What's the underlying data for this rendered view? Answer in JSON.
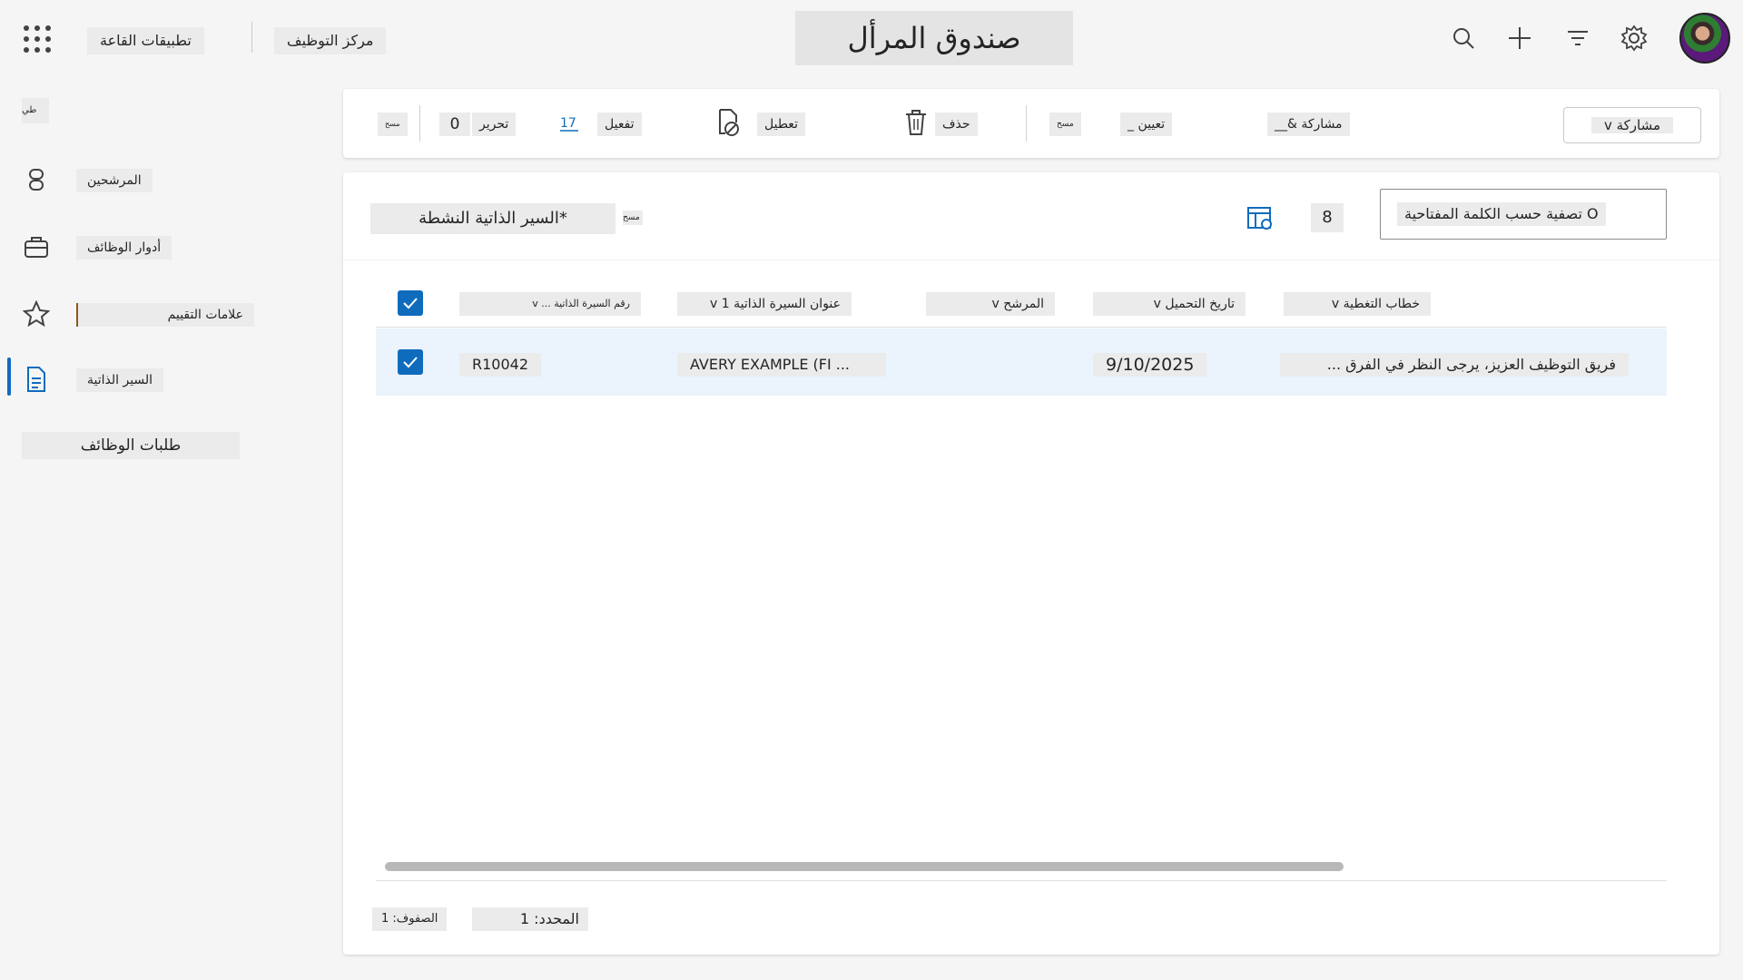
{
  "header": {
    "app_links": [
      "تطبيقات القاعة",
      "مركز التوظيف"
    ],
    "page_title": "صندوق المرأل",
    "icons": [
      "waffle-icon",
      "search-icon",
      "plus-icon",
      "filter-icon",
      "gear-icon",
      "avatar"
    ]
  },
  "sidebar": {
    "collapse_label": "طي",
    "items": [
      {
        "label": "المرشحين",
        "icon": "people-icon"
      },
      {
        "label": "أدوار الوظائف",
        "icon": "briefcase-icon"
      },
      {
        "label": "علامات التقييم",
        "icon": "star-icon"
      },
      {
        "label": "السير الذاتية",
        "icon": "document-icon"
      }
    ],
    "manage_label": "طلبات الوظائف"
  },
  "commandbar": {
    "view_selector": "مشاركة v",
    "share_label": "مشاركة &__",
    "assign_label": "تعيين _",
    "more_label": "مسح",
    "delete_label": "حذف",
    "deactivate_label": "تعطيل",
    "activate_label": "تفعيل",
    "activate_number": "17",
    "counter_label": "تحرير",
    "counter_value": "0",
    "overflow_label": "مسح"
  },
  "view": {
    "name": "*السير الذاتية النشطة",
    "chevron": "مسح",
    "count": "8",
    "search_placeholder": "O تصفية حسب الكلمة المفتاحية"
  },
  "table": {
    "columns": [
      "رقم السيرة الذاتية ... v",
      "عنوان السيرة الذاتية 1 v",
      "المرشح v",
      "تاريخ التحميل v",
      "خطاب التغطية v"
    ],
    "rows": [
      {
        "id": "R10042",
        "title": "AVERY EXAMPLE (FI ...",
        "candidate": "",
        "date": "9/10/2025",
        "cover": "فريق التوظيف العزيز، يرجى النظر في الفرق ..."
      }
    ]
  },
  "footer": {
    "rows_label": "الصفوف: 1",
    "selected_label": "المحدد: 1"
  },
  "colors": {
    "accent": "#0f6cbd",
    "selected_row": "#ebf3fc",
    "background": "#f5f5f5"
  }
}
